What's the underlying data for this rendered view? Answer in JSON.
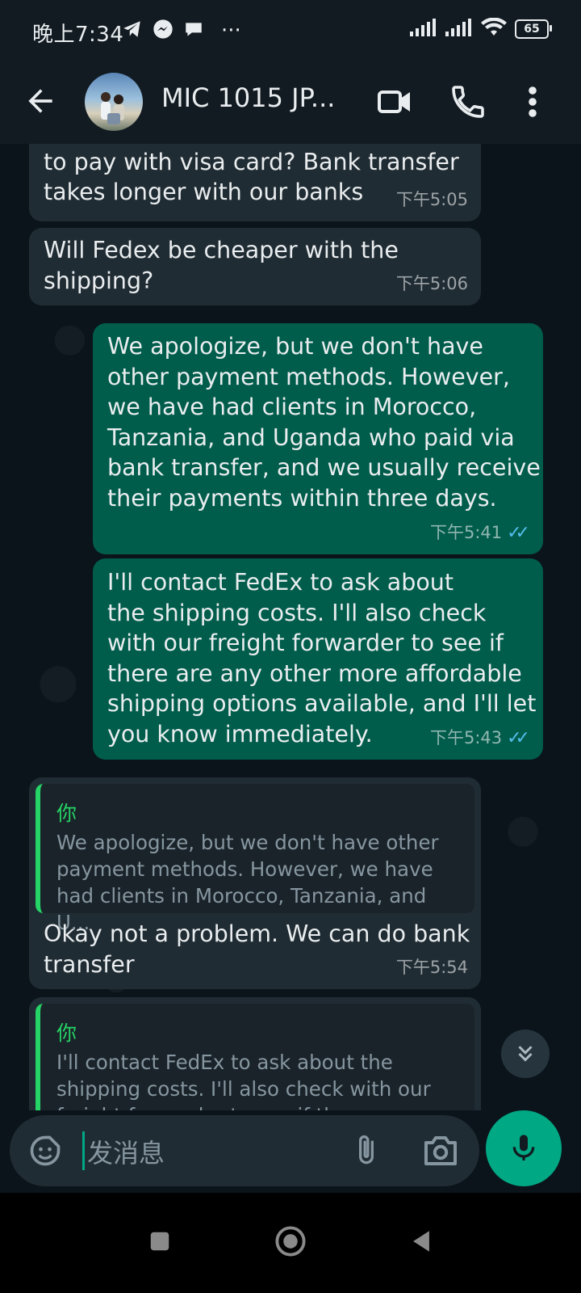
{
  "status_bar": {
    "time": "晚上7:34",
    "left_icons": [
      "telegram-icon",
      "messenger-icon",
      "chat-bubble-icon",
      "more-notifications-icon"
    ],
    "more_dots": "···",
    "battery": "65"
  },
  "header": {
    "contact_name": "MIC 1015 JP...",
    "icons": [
      "back-arrow-icon",
      "video-call-icon",
      "phone-call-icon",
      "more-vert-icon"
    ]
  },
  "messages": [
    {
      "direction": "in",
      "text": "method we can use? Maybe a link\nto pay with visa card?  Bank transfer\ntakes longer with our banks",
      "time": "下午5:05"
    },
    {
      "direction": "in",
      "text": "Will Fedex be cheaper with the\nshipping?",
      "time": "下午5:06"
    },
    {
      "direction": "out",
      "text": "We apologize, but we don't have\nother payment methods. However,\nwe have had clients in Morocco,\nTanzania, and Uganda who paid via\nbank transfer, and we usually receive\ntheir payments within three days.",
      "time": "下午5:41",
      "read": true
    },
    {
      "direction": "out",
      "text": "I'll contact FedEx to ask about\nthe shipping costs. I'll also check\nwith our freight forwarder to see if\nthere are any other more affordable\nshipping options available, and I'll let\nyou know immediately.",
      "time": "下午5:43",
      "read": true
    },
    {
      "direction": "in",
      "quote_author": "你",
      "quote_text": "We apologize, but we don't have other\npayment methods. However, we have\nhad clients in Morocco, Tanzania, and U...",
      "text": "Okay not a problem. We can do bank\ntransfer",
      "time": "下午5:54"
    },
    {
      "direction": "in",
      "quote_author": "你",
      "quote_text": "I'll contact FedEx to ask about the\nshipping costs. I'll also check with our\nfreight forwarder to see if th..."
    }
  ],
  "input": {
    "placeholder": "发消息"
  },
  "colors": {
    "background": "#0b141a",
    "incoming_bubble": "#202c33",
    "outgoing_bubble": "#005c4b",
    "accent": "#00a884",
    "read_ticks": "#53bdeb"
  }
}
